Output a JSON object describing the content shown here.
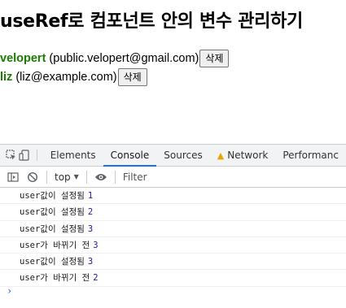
{
  "page": {
    "heading": "useRef로 컴포넌트 안의 변수 관리하기",
    "users": [
      {
        "username": "velopert",
        "email": "(public.velopert@gmail.com)",
        "delete_label": "삭제"
      },
      {
        "username": "liz",
        "email": "(liz@example.com)",
        "delete_label": "삭제"
      }
    ]
  },
  "devtools": {
    "tabs": [
      "Elements",
      "Console",
      "Sources",
      "Network",
      "Performanc"
    ],
    "active_tab": "Console",
    "context": "top",
    "filter_placeholder": "Filter",
    "logs": [
      {
        "text": "user값이 설정됨",
        "value": "1"
      },
      {
        "text": "user값이 설정됨",
        "value": "2"
      },
      {
        "text": "user값이 설정됨",
        "value": "3"
      },
      {
        "text": "user가 바뀌기 전",
        "value": "3"
      },
      {
        "text": "user값이 설정됨",
        "value": "3"
      },
      {
        "text": "user가 바뀌기 전",
        "value": "2"
      }
    ],
    "prompt_symbol": "›"
  },
  "colors": {
    "username": "#1a7d00",
    "active_tab_underline": "#1a73e8",
    "warning": "#e8a600",
    "log_number": "#1a1aa6"
  },
  "icons": [
    "inspect-icon",
    "device-toggle-icon",
    "warning-icon",
    "sidebar-toggle-icon",
    "clear-console-icon",
    "eye-icon",
    "caret-down-icon"
  ]
}
